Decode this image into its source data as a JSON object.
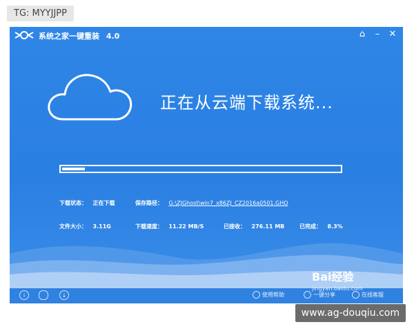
{
  "overlay_tag": "TG: MYYJJPP",
  "window": {
    "title": "系统之家一键重装",
    "version": "4.0",
    "controls": {
      "home_icon": "home-icon",
      "minimize_icon": "minimize-icon",
      "close_icon": "close-icon"
    }
  },
  "status_headline": "正在从云端下载系统...",
  "progress": {
    "value": 0.083
  },
  "info": {
    "status_label": "下载状态：",
    "status_value": "正在下载",
    "path_label": "保存路径：",
    "path_value": "G:\\ZJGhost\\win7_x86ZJ_CZ2016a0501.GHO",
    "size_label": "文件大小：",
    "size_value": "3.11G",
    "speed_label": "下载速度：",
    "speed_value": "11.22 MB/S",
    "received_label": "已接收：",
    "received_value": "276.11 MB",
    "completed_label": "已完成：",
    "completed_value": "8.3%"
  },
  "bottom": {
    "help": "使用帮助",
    "share": "一键分享",
    "service": "在线客服"
  },
  "watermark": {
    "brand": "Bai经验",
    "url": "jingyan.baidu.com"
  },
  "site_tag": "www.ag-douqiu.com",
  "colors": {
    "window_bg": "#2a7fe2",
    "wave": "#6aa8ee",
    "white": "#ffffff"
  }
}
